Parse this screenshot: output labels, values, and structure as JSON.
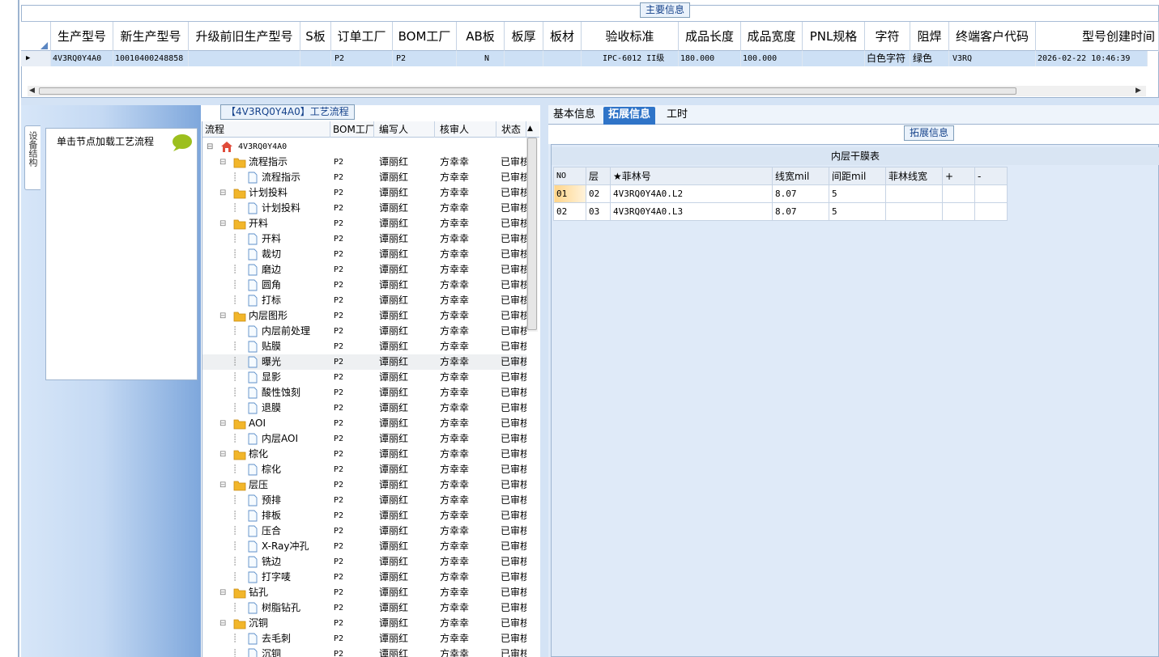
{
  "main_info": {
    "title": "主要信息",
    "columns": [
      "生产型号",
      "新生产型号",
      "升级前旧生产型号",
      "S板",
      "订单工厂",
      "BOM工厂",
      "AB板",
      "板厚",
      "板材",
      "验收标准",
      "成品长度",
      "成品宽度",
      "PNL规格",
      "字符",
      "阻焊",
      "终端客户代码",
      "型号创建时间"
    ],
    "row": {
      "prod_no": "4V3RQ0Y4A0",
      "new_prod_no": "10010400248858",
      "old_prod_no": "",
      "s_board": "",
      "order_factory": "P2",
      "bom_factory": "P2",
      "ab_board": "N",
      "thickness": "",
      "material": "",
      "standard": "IPC-6012 II级",
      "length": "180.000",
      "width": "100.000",
      "pnl": "",
      "char": "白色字符",
      "mask": "绿色",
      "customer": "V3RQ",
      "created": "2026-02-22 10:46:39"
    }
  },
  "process_flow": {
    "title": "【4V3RQ0Y4A0】工艺流程",
    "side_tab": "设备结构",
    "hint": "单击节点加载工艺流程",
    "columns": [
      "流程",
      "BOM工厂",
      "编写人",
      "核审人",
      "状态"
    ],
    "root": "4V3RQ0Y4A0",
    "rows": [
      {
        "name": "流程指示",
        "level": 1,
        "folder": true
      },
      {
        "name": "流程指示",
        "level": 2,
        "folder": false
      },
      {
        "name": "计划投料",
        "level": 1,
        "folder": true
      },
      {
        "name": "计划投料",
        "level": 2,
        "folder": false
      },
      {
        "name": "开料",
        "level": 1,
        "folder": true
      },
      {
        "name": "开料",
        "level": 2,
        "folder": false
      },
      {
        "name": "裁切",
        "level": 2,
        "folder": false
      },
      {
        "name": "磨边",
        "level": 2,
        "folder": false
      },
      {
        "name": "圆角",
        "level": 2,
        "folder": false
      },
      {
        "name": "打标",
        "level": 2,
        "folder": false
      },
      {
        "name": "内层图形",
        "level": 1,
        "folder": true
      },
      {
        "name": "内层前处理",
        "level": 2,
        "folder": false
      },
      {
        "name": "贴膜",
        "level": 2,
        "folder": false
      },
      {
        "name": "曝光",
        "level": 2,
        "folder": false,
        "selected": true
      },
      {
        "name": "显影",
        "level": 2,
        "folder": false
      },
      {
        "name": "酸性蚀刻",
        "level": 2,
        "folder": false
      },
      {
        "name": "退膜",
        "level": 2,
        "folder": false
      },
      {
        "name": "AOI",
        "level": 1,
        "folder": true
      },
      {
        "name": "内层AOI",
        "level": 2,
        "folder": false
      },
      {
        "name": "棕化",
        "level": 1,
        "folder": true
      },
      {
        "name": "棕化",
        "level": 2,
        "folder": false
      },
      {
        "name": "层压",
        "level": 1,
        "folder": true
      },
      {
        "name": "预排",
        "level": 2,
        "folder": false
      },
      {
        "name": "排板",
        "level": 2,
        "folder": false
      },
      {
        "name": "压合",
        "level": 2,
        "folder": false
      },
      {
        "name": "X-Ray冲孔",
        "level": 2,
        "folder": false
      },
      {
        "name": "铣边",
        "level": 2,
        "folder": false
      },
      {
        "name": "打字唛",
        "level": 2,
        "folder": false
      },
      {
        "name": "钻孔",
        "level": 1,
        "folder": true
      },
      {
        "name": "树脂钻孔",
        "level": 2,
        "folder": false
      },
      {
        "name": "沉铜",
        "level": 1,
        "folder": true
      },
      {
        "name": "去毛刺",
        "level": 2,
        "folder": false
      },
      {
        "name": "沉铜",
        "level": 2,
        "folder": false
      }
    ],
    "row_values": {
      "bom": "P2",
      "writer": "谭丽红",
      "reviewer": "方幸幸",
      "status": "已审核"
    }
  },
  "tabs": [
    "基本信息",
    "拓展信息",
    "工时"
  ],
  "active_tab": "拓展信息",
  "ext_info": {
    "title": "拓展信息",
    "table_title": "内层干膜表",
    "columns": [
      "NO",
      "层",
      "★菲林号",
      "线宽mil",
      "间距mil",
      "菲林线宽",
      "+",
      "-"
    ],
    "rows": [
      [
        "01",
        "02",
        "4V3RQ0Y4A0.L2",
        "8.07",
        "5",
        "",
        "",
        ""
      ],
      [
        "02",
        "03",
        "4V3RQ0Y4A0.L3",
        "8.07",
        "5",
        "",
        "",
        ""
      ]
    ]
  },
  "colors": {
    "accent": "#2f74c8",
    "header_bg": "#e8eef6",
    "selected_row": "#cde0f5",
    "panel_bg": "#dfeaf8"
  }
}
